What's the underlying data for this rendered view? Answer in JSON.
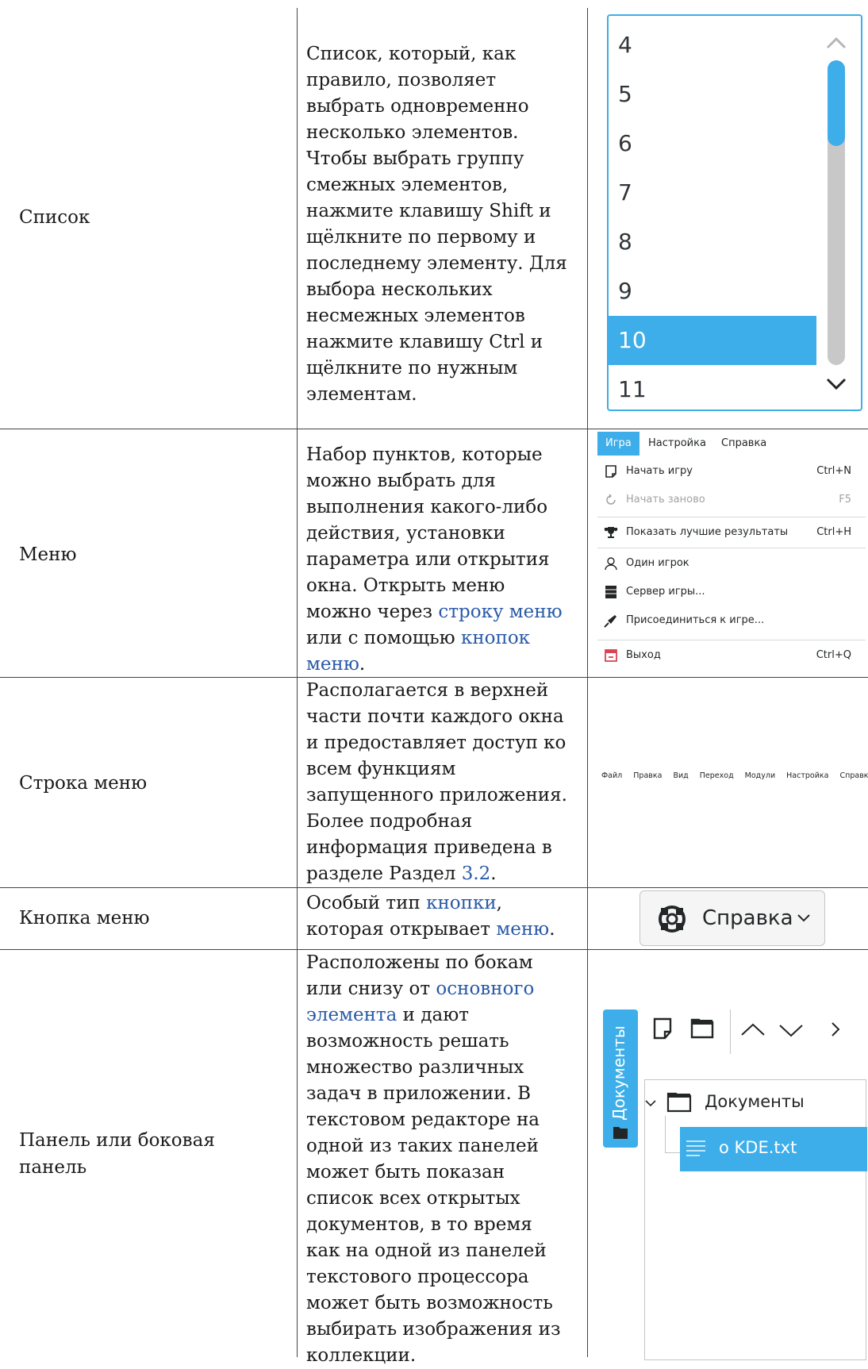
{
  "rows": [
    {
      "label": "Список",
      "desc": [
        "Список, который, как",
        "правило, позволяет",
        "выбрать одновременно",
        "несколько элементов.",
        "Чтобы выбрать группу",
        "смежных элементов,",
        "нажмите клавишу Shift и",
        "щёлкните по первому и",
        "последнему элементу. Для",
        "выбора нескольких",
        "несмежных элементов",
        "нажмите клавишу Ctrl и",
        "щёлкните по нужным",
        "элементам."
      ]
    },
    {
      "label": "Меню",
      "desc_plain": [
        "Набор пунктов, которые",
        "можно выбрать для",
        "выполнения какого-либо",
        "действия, установки",
        "параметра или открытия",
        "окна. Открыть меню",
        "можно через "
      ],
      "link1": "строку меню",
      "mid": "или с помощью ",
      "link2a": "кнопок",
      "link2b": "меню",
      "end": "."
    },
    {
      "label": "Строка меню",
      "desc": [
        "Располагается в верхней",
        "части почти каждого окна",
        "и предоставляет доступ ко",
        "всем функциям",
        "запущенного приложения.",
        "Более подробная",
        "информация приведена в"
      ],
      "last_prefix": "разделе Раздел ",
      "last_link": "3.2",
      "last_suffix": "."
    },
    {
      "label": "Кнопка меню",
      "l1_prefix": "Особый тип ",
      "l1_link": "кнопки",
      "l1_suffix": ",",
      "l2_prefix": "которая открывает ",
      "l2_link": "меню",
      "l2_suffix": "."
    },
    {
      "label_l1": "Панель или боковая",
      "label_l2": "панель",
      "d1": "Расположены по бокам",
      "d2_prefix": "или снизу от ",
      "d2_link": "основного",
      "d3_link": "элемента",
      "d3_suffix": " и дают",
      "rest": [
        "возможность решать",
        "множество различных",
        "задач в приложении. В",
        "текстовом редакторе на",
        "одной из таких панелей",
        "может быть показан",
        "список всех открытых",
        "документов, в то время",
        "как на одной из панелей",
        "текстового процессора",
        "может быть возможность",
        "выбирать изображения из",
        "коллекции."
      ]
    }
  ],
  "list_widget": {
    "items": [
      "4",
      "5",
      "6",
      "7",
      "8",
      "9",
      "10",
      "11"
    ],
    "selected": "10",
    "scroll_fraction": 0.28
  },
  "menu": {
    "tabs": [
      "Игра",
      "Настройка",
      "Справка"
    ],
    "items": [
      {
        "label": "Начать игру",
        "shortcut": "Ctrl+N"
      },
      {
        "label": "Начать заново",
        "shortcut": "F5"
      },
      {
        "label": "Показать лучшие результаты",
        "shortcut": "Ctrl+H"
      },
      {
        "label": "Один игрок",
        "shortcut": ""
      },
      {
        "label": "Сервер игры...",
        "shortcut": ""
      },
      {
        "label": "Присоединиться к игре...",
        "shortcut": ""
      },
      {
        "label": "Выход",
        "shortcut": "Ctrl+Q"
      }
    ]
  },
  "menubar_strip": [
    "Файл",
    "Правка",
    "Вид",
    "Переход",
    "Модули",
    "Настройка",
    "Справка"
  ],
  "menu_button": {
    "label": "Справка"
  },
  "panel": {
    "tab_label": "Документы",
    "folder_label": "Документы",
    "file_label": "о KDE.txt"
  },
  "colors": {
    "accent": "#3daee9",
    "link": "#2a5aa8"
  }
}
